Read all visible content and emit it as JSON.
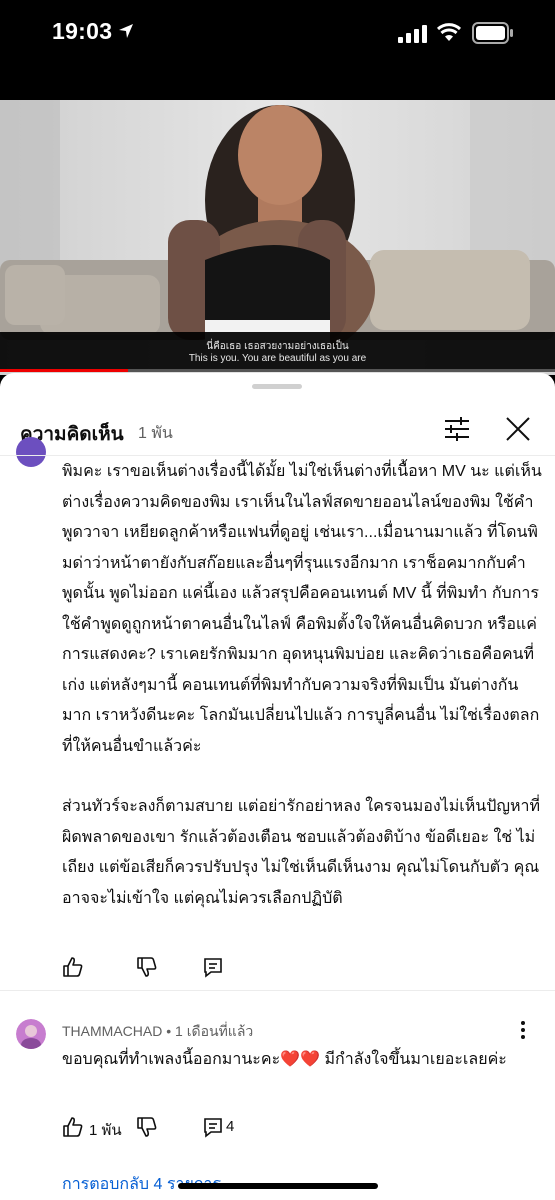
{
  "status_bar": {
    "time": "19:03",
    "icons": [
      "location-arrow-icon",
      "cellular-signal-icon",
      "wifi-icon",
      "battery-icon"
    ]
  },
  "video": {
    "subtitle_thai": "นี่คือเธอ เธอสวยงามอย่างเธอเป็น",
    "subtitle_english": "This is you. You are beautiful as you are",
    "progress_fraction": 0.23
  },
  "comments_sheet": {
    "title": "ความคิดเห็น",
    "count": "1 พัน",
    "filter_icon": "sort-filter-icon",
    "close_icon": "close-icon"
  },
  "comment_1": {
    "paragraph_1": "พิมคะ เราขอเห็นต่างเรื่องนี้ได้มั้ย ไม่ใช่เห็นต่างที่เนื้อหา MV นะ แต่เห็นต่างเรื่องความคิดของพิม เราเห็นในไลฟ์สดขายออนไลน์ของพิม ใช้คำพูดวาจา เหยียดลูกค้าหรือแฟนที่ดูอยู่ เช่นเรา...เมื่อนานมาแล้ว ที่โดนพิมด่าว่าหน้าตายังกับสก๊อยและอื่นๆที่รุนแรงอีกมาก เราช็อคมากกับคำพูดนั้น พูดไม่ออก แค่นี้เอง แล้วสรุปคือคอนเทนต์ MV นี้ ที่พิมทำ กับการใช้คำพูดดูถูกหน้าตาคนอื่นในไลฟ์ คือพิมตั้งใจให้คนอื่นคิดบวก หรือแค่การแสดงคะ? เราเคยรักพิมมาก อุดหนุนพิมบ่อย และคิดว่าเธอคือคนที่เก่ง แต่หลังๆมานี้ คอนเทนต์ที่พิมทำกับความจริงที่พิมเป็น มันต่างกันมาก เราหวังดีนะคะ โลกมันเปลี่ยนไปแล้ว การบูลี่คนอื่น ไม่ใช่เรื่องตลกที่ให้คนอื่นขำแล้วค่ะ",
    "paragraph_2": "ส่วนทัวร์จะลงก็ตามสบาย แต่อย่ารักอย่าหลง ใครจนมองไม่เห็นปัญหาที่ผิดพลาดของเขา รักแล้วต้องเตือน ชอบแล้วต้องติบ้าง ข้อดีเยอะ ใช่ ไม่เถียง แต่ข้อเสียก็ควรปรับปรุง ไม่ใช่เห็นดีเห็นงาม คุณไม่โดนกับตัว คุณอาจจะไม่เข้าใจ แต่คุณไม่ควรเลือกปฏิบัติ",
    "actions": [
      "like-icon",
      "dislike-icon",
      "reply-icon"
    ]
  },
  "comment_2": {
    "author": "THAMMACHAD",
    "separator": " • ",
    "time_ago": "1 เดือนที่แล้ว",
    "text": "ขอบคุณที่ทำเพลงนี้ออกมานะคะ❤️❤️ มีกำลังใจขึ้นมาเยอะเลยค่ะ",
    "like_count": "1 พัน",
    "reply_count": "4",
    "replies_link": "การตอบกลับ 4 รายการ"
  }
}
